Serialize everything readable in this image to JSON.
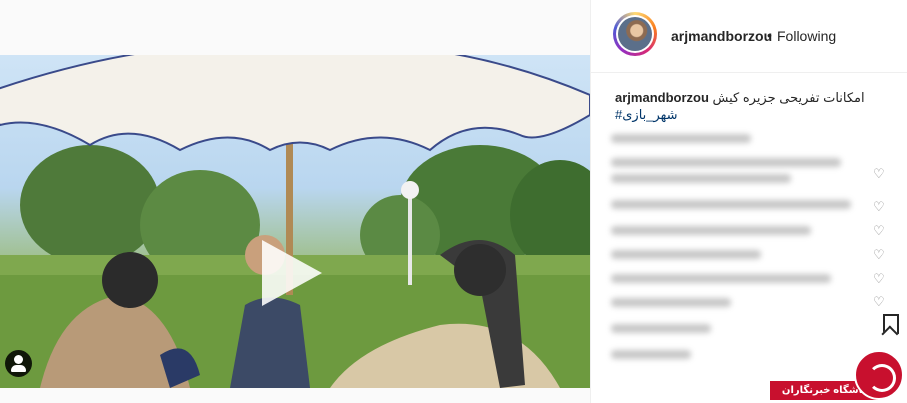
{
  "post": {
    "username": "arjmandborzou",
    "separator": "•",
    "follow_status": "Following",
    "caption_user": "arjmandborzou",
    "caption_text": "امکانات تفریحی جزیره کیش",
    "hashtag": "#شهر_بازی",
    "watermark_text": "باشگاه خبرنگاران"
  },
  "icons": {
    "play": "play-icon",
    "user_tag": "user-tag-icon",
    "like": "heart-icon",
    "save": "bookmark-icon"
  },
  "colors": {
    "link": "#003569",
    "watermark": "#c8102e"
  }
}
